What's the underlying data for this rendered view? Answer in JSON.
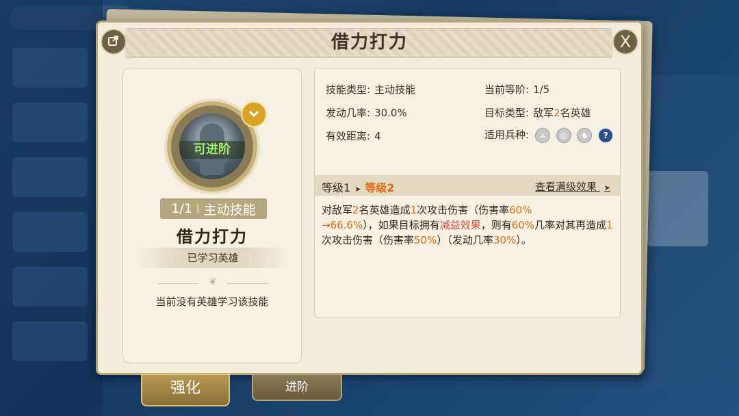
{
  "dialog": {
    "title": "借力打力",
    "share_icon": "share-icon",
    "close_label": "X"
  },
  "skill_card": {
    "status_overlay": "可进阶",
    "badge_icon": "chevron-down-icon",
    "level": "1/1",
    "type_label": "主动技能",
    "name": "借力打力",
    "learned_heroes_label": "已学习英雄",
    "no_hero_text": "当前没有英雄学习该技能"
  },
  "info": {
    "skill_type_label": "技能类型:",
    "skill_type_value": "主动技能",
    "rank_label": "当前等阶:",
    "rank_value": "1/5",
    "trigger_rate_label": "发动几率:",
    "trigger_rate_value": "30.0%",
    "target_type_label": "目标类型:",
    "target_type_pre": "敌军",
    "target_type_num": "2",
    "target_type_post": "名英雄",
    "range_label": "有效距离:",
    "range_value": "4",
    "unit_types_label": "适用兵种:",
    "unit_icons": [
      "sword-icon",
      "target-icon",
      "horse-icon",
      "question-icon"
    ]
  },
  "level_bar": {
    "current": "等级1",
    "arrow": "➤",
    "next": "等级2",
    "view_full": "查看满级效果",
    "view_arrow": "➤"
  },
  "description": {
    "p1": "对敌军",
    "n1": "2",
    "p2": "名英雄造成",
    "n2": "1",
    "p3": "次攻击伤害（伤害率",
    "n3": "60%",
    "n4": "→66.6%",
    "p4": "），如果目标拥有",
    "debuff": "减益效果",
    "p5": "，则有",
    "n5": "60%",
    "p6": "几率对其再造成",
    "n6": "1",
    "p7": "次攻击伤害（伤害率",
    "n7": "50%",
    "p8": "）（发动几率",
    "n8": "30%",
    "p9": "）。"
  },
  "tabs": {
    "strengthen": "强化",
    "advance": "进阶"
  },
  "colors": {
    "highlight": "#e06c10",
    "debuff": "#e2473b",
    "advance_text": "#9cf06a",
    "panel_bg": "#f2ecdc"
  }
}
